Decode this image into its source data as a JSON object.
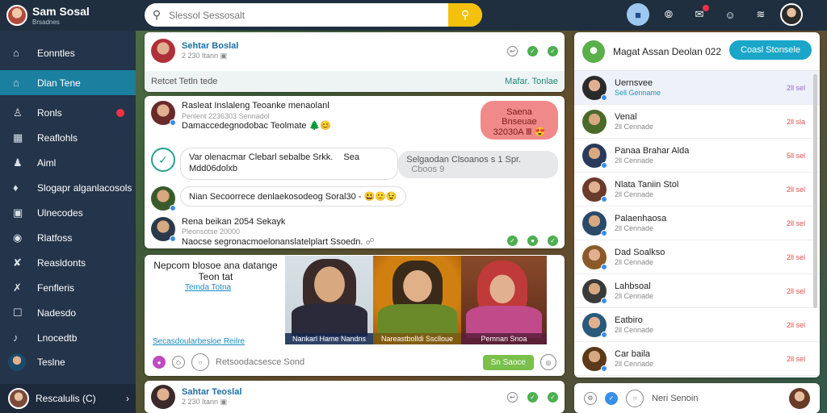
{
  "brand": {
    "name": "Sam Sosal",
    "subtitle": "Brsadnes"
  },
  "search": {
    "placeholder": "Slessol Sessosalt"
  },
  "sidebar": {
    "items": [
      {
        "label": "Eonntles",
        "icon": "home-icon"
      },
      {
        "label": "Dlan Tene",
        "icon": "home-icon"
      },
      {
        "label": "Ronls",
        "icon": "people-icon"
      },
      {
        "label": "Reaflohls",
        "icon": "grid-icon"
      },
      {
        "label": "Aiml",
        "icon": "user-icon"
      },
      {
        "label": "Slogapr alganlacosols",
        "icon": "tag-icon"
      },
      {
        "label": "Ulnecodes",
        "icon": "calendar-icon"
      },
      {
        "label": "Rlatfoss",
        "icon": "circle-icon"
      },
      {
        "label": "Reasldonts",
        "icon": "share-icon"
      },
      {
        "label": "Fenfleris",
        "icon": "cross-icon"
      },
      {
        "label": "Nadesdo",
        "icon": "chat-icon"
      },
      {
        "label": "Lnocedtb",
        "icon": "bell-icon"
      }
    ],
    "user_item": "Teslne",
    "footer_label": "Rescalulis (C)"
  },
  "post1": {
    "name": "Sehtar Boslal",
    "time": "2 230 Itann",
    "footer_left": "Retcet Tetln tede",
    "footer_right": "Mafar. Tonlae"
  },
  "messages": {
    "m1": {
      "title": "Rasleat Inslaleng Teoanke menaolanl",
      "meta": "Penlent 2236303 Sennadol",
      "body": "Damaccedegnodobac Teolmate",
      "emoji": "🌲😊"
    },
    "m1_bubble": {
      "line1": "Saena Bnseuae",
      "line2": "32030A Ⅲ",
      "emoji": "😍"
    },
    "m2": {
      "line1": "Var olenacmar Clebarl sebalbe Srkk.",
      "line2": "Mdd06dolxb",
      "side": "Sea"
    },
    "m2_bubble": {
      "text": "Selgaodan Clsoanos s 1 Spr.",
      "tail": "Cboos 9"
    },
    "m3": {
      "text": "Nian Secoorrece denlaekosodeog Soral30 -",
      "emoji": "😃🙂😉"
    },
    "m4": {
      "title": "Rena beikan 2054 Sekayk",
      "meta": "Pleonsotse 20000",
      "body": "Naocse segronacmoelonanslatelplart Ssoedn."
    }
  },
  "feature": {
    "title": "Nepcom blosoe ana datange Teon tat",
    "link": "Temda Totna",
    "footer_link": "Secasdoularbesloe Reilre",
    "photos": [
      {
        "caption": "Nankarl Hame Nandns"
      },
      {
        "caption": "Nareastbolldi Ssclloue"
      },
      {
        "caption": "Pemnan Snoa"
      }
    ],
    "composer_placeholder": "Retsoodacsesce Sond",
    "composer_button": "Sn Saoce"
  },
  "post2": {
    "name": "Sahtar Teoslal",
    "time": "2 230 Itann"
  },
  "right_panel": {
    "title": "Magat Assan Deolan 022",
    "button": "Coasl Stonsele",
    "contacts": [
      {
        "name": "Uernsvee",
        "status": "Sell Genname",
        "time": "2ll sel"
      },
      {
        "name": "Venal",
        "status": "2ll Cennade",
        "time": "2ll sla"
      },
      {
        "name": "Panaa Brahar Alda",
        "status": "2ll Cennade",
        "time": "5ll sel"
      },
      {
        "name": "Nlata Taniin Stol",
        "status": "2ll Cennade",
        "time": "2ll sel"
      },
      {
        "name": "Palaenhaosa",
        "status": "2ll Cennade",
        "time": "2ll sel"
      },
      {
        "name": "Dad Soalkso",
        "status": "2ll Cennade",
        "time": "2ll sel"
      },
      {
        "name": "Lahbsoal",
        "status": "2ll Cennade",
        "time": "2ll sel"
      },
      {
        "name": "Eatbiro",
        "status": "2ll Cennade",
        "time": "2ll sel"
      },
      {
        "name": "Car baila",
        "status": "2ll Cennade",
        "time": "2ll sel"
      }
    ],
    "footer_label": "Neri Senoin"
  }
}
